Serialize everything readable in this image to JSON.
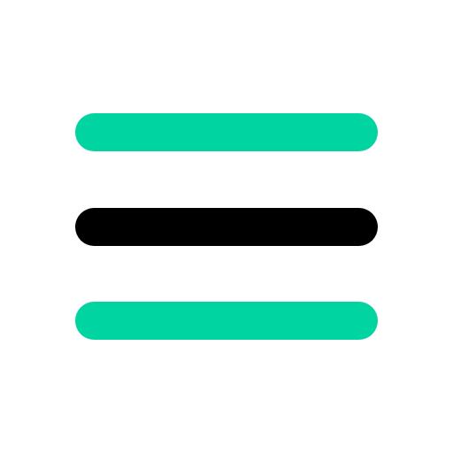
{
  "icon": {
    "name": "hamburger-menu-icon",
    "colors": {
      "accent": "#00D4A0",
      "middle": "#000000",
      "background": "#FFFFFF"
    },
    "bars": [
      {
        "color": "#00D4A0"
      },
      {
        "color": "#000000"
      },
      {
        "color": "#00D4A0"
      }
    ]
  }
}
